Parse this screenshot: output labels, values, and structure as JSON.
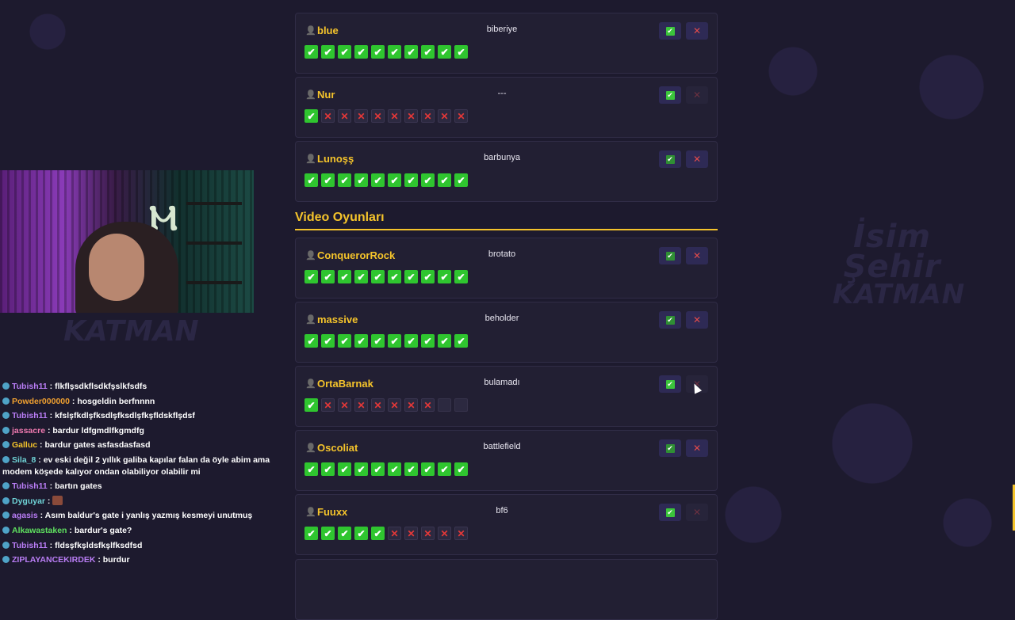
{
  "section": {
    "title": "Video Oyunları"
  },
  "cards_top": [
    {
      "name": "blue",
      "answer": "biberiye",
      "ok_dim": false,
      "no_dim": false,
      "votes": [
        "yes",
        "yes",
        "yes",
        "yes",
        "yes",
        "yes",
        "yes",
        "yes",
        "yes",
        "yes"
      ]
    },
    {
      "name": "Nur",
      "answer": "---",
      "ok_dim": false,
      "no_dim": true,
      "votes": [
        "yes",
        "no",
        "no",
        "no",
        "no",
        "no",
        "no",
        "no",
        "no",
        "no"
      ]
    },
    {
      "name": "Lunoşş",
      "answer": "barbunya",
      "ok_dim": true,
      "no_dim": false,
      "votes": [
        "yes",
        "yes",
        "yes",
        "yes",
        "yes",
        "yes",
        "yes",
        "yes",
        "yes",
        "yes"
      ]
    }
  ],
  "cards_bottom": [
    {
      "name": "ConquerorRock",
      "answer": "brotato",
      "ok_dim": true,
      "no_dim": false,
      "votes": [
        "yes",
        "yes",
        "yes",
        "yes",
        "yes",
        "yes",
        "yes",
        "yes",
        "yes",
        "yes"
      ]
    },
    {
      "name": "massive",
      "answer": "beholder",
      "ok_dim": true,
      "no_dim": false,
      "votes": [
        "yes",
        "yes",
        "yes",
        "yes",
        "yes",
        "yes",
        "yes",
        "yes",
        "yes",
        "yes"
      ]
    },
    {
      "name": "OrtaBarnak",
      "answer": "bulamadı",
      "ok_dim": false,
      "no_dim": true,
      "votes": [
        "yes",
        "no",
        "no",
        "no",
        "no",
        "no",
        "no",
        "no",
        "empty",
        "empty"
      ]
    },
    {
      "name": "Oscoliat",
      "answer": "battlefield",
      "ok_dim": true,
      "no_dim": false,
      "votes": [
        "yes",
        "yes",
        "yes",
        "yes",
        "yes",
        "yes",
        "yes",
        "yes",
        "yes",
        "yes"
      ]
    },
    {
      "name": "Fuuxx",
      "answer": "bf6",
      "ok_dim": false,
      "no_dim": true,
      "votes": [
        "yes",
        "yes",
        "yes",
        "yes",
        "yes",
        "no",
        "no",
        "no",
        "no",
        "no"
      ]
    }
  ],
  "chat": [
    {
      "user": "Tubish11",
      "color": "#b97df5",
      "msg": "flkflşsdkflsdkfşslkfsdfs"
    },
    {
      "user": "Powder000000",
      "color": "#f0a030",
      "msg": "hosgeldin berfnnnn"
    },
    {
      "user": "Tubish11",
      "color": "#b97df5",
      "msg": "kfslşfkdlşfksdlşfksdlşfkşfldskflşdsf"
    },
    {
      "user": "jassacre",
      "color": "#f07ab0",
      "msg": "bardur ldfgmdlfkgmdfg"
    },
    {
      "user": "Galluc",
      "color": "#f5c42b",
      "msg": "bardur gates asfasdasfasd"
    },
    {
      "user": "Sila_8",
      "color": "#6fd3d6",
      "msg": "ev eski değil 2 yıllık galiba kapılar falan da öyle abim ama modem köşede kalıyor ondan olabiliyor olabilir mi"
    },
    {
      "user": "Tubish11",
      "color": "#b97df5",
      "msg": "bartın gates"
    },
    {
      "user": "Dyguyar",
      "color": "#6fd3d6",
      "msg": ""
    },
    {
      "user": "agasis",
      "color": "#b97df5",
      "msg": "Asım baldur's gate i yanlış yazmış kesmeyi unutmuş"
    },
    {
      "user": "Alkawastaken",
      "color": "#5fe05f",
      "msg": "bardur's gate?"
    },
    {
      "user": "Tubish11",
      "color": "#b97df5",
      "msg": "fldsşfkşldsfkşlfksdfsd"
    },
    {
      "user": "ZIPLAYANCEKIRDEK",
      "color": "#b97df5",
      "msg": "burdur"
    }
  ],
  "watermark": {
    "line1": "İsim",
    "line2": "Şehir",
    "line3": "KATMAN"
  },
  "cam_caption": "KATMAN",
  "icons": {
    "user": "user-icon",
    "check": "check-icon",
    "cross": "cross-icon"
  }
}
